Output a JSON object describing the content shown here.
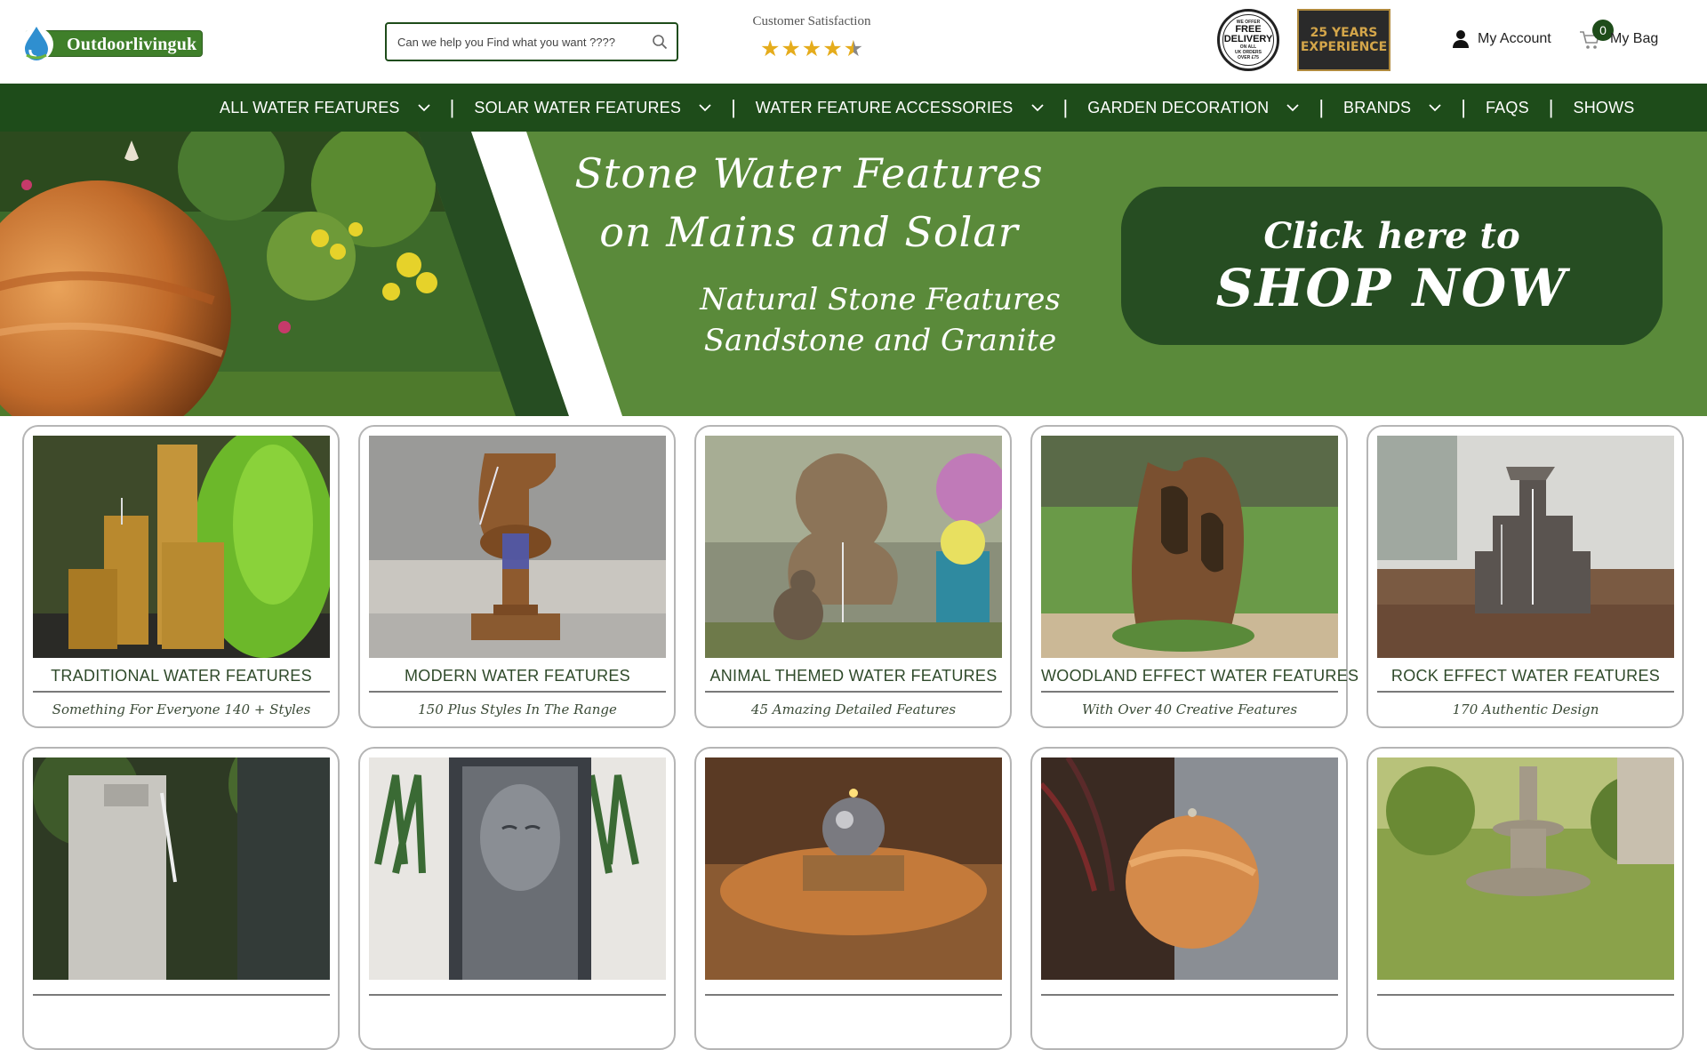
{
  "header": {
    "logo_text": "Outdoorlivinguk",
    "search_placeholder": "Can we help you Find what you want ????",
    "satisfaction_label": "Customer Satisfaction",
    "rating": 4.5,
    "rating_max": 5,
    "delivery_badge": {
      "top": "WE OFFER",
      "line1": "FREE",
      "line2": "DELIVERY",
      "bottom1": "ON ALL",
      "bottom2": "UK ORDERS",
      "bottom3": "OVER £75"
    },
    "years_badge": {
      "line1": "25 YEARS",
      "line2": "EXPERIENCE"
    },
    "account_label": "My Account",
    "bag_label": "My Bag",
    "bag_count": "0"
  },
  "nav": {
    "items": [
      {
        "label": "ALL WATER FEATURES",
        "has_dropdown": true
      },
      {
        "label": "SOLAR WATER FEATURES",
        "has_dropdown": true
      },
      {
        "label": "WATER FEATURE ACCESSORIES",
        "has_dropdown": true
      },
      {
        "label": "GARDEN DECORATION",
        "has_dropdown": true
      },
      {
        "label": "BRANDS",
        "has_dropdown": true
      },
      {
        "label": "FAQS",
        "has_dropdown": false
      },
      {
        "label": "SHOWS",
        "has_dropdown": false
      }
    ],
    "separator": "|"
  },
  "hero": {
    "title_line1": "Stone Water Features",
    "title_line2": "on Mains and Solar",
    "sub_line1": "Natural Stone Features",
    "sub_line2": "Sandstone and Granite",
    "cta_top": "Click here to",
    "cta_main": "SHOP NOW"
  },
  "categories": [
    {
      "title": "TRADITIONAL WATER FEATURES",
      "subtitle": "Something For Everyone 140 + Styles"
    },
    {
      "title": "MODERN WATER FEATURES",
      "subtitle": "150 Plus Styles In The Range"
    },
    {
      "title": "ANIMAL THEMED WATER FEATURES",
      "subtitle": "45 Amazing Detailed Features"
    },
    {
      "title": "WOODLAND EFFECT WATER FEATURES",
      "subtitle": "With Over 40 Creative Features"
    },
    {
      "title": "ROCK EFFECT WATER FEATURES",
      "subtitle": "170 Authentic Design"
    },
    {
      "title": "",
      "subtitle": ""
    },
    {
      "title": "",
      "subtitle": ""
    },
    {
      "title": "",
      "subtitle": ""
    },
    {
      "title": "",
      "subtitle": ""
    },
    {
      "title": "",
      "subtitle": ""
    }
  ],
  "colors": {
    "brand_dark_green": "#1e4c1a",
    "hero_green": "#5a8a3a",
    "cta_green": "#264d22",
    "star_gold": "#e5ac1c"
  }
}
